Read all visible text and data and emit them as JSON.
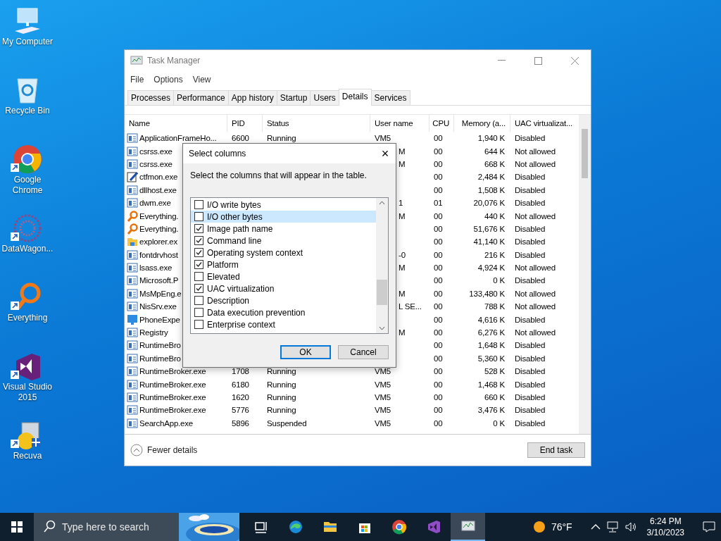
{
  "desktop_icons": [
    {
      "label": "My Computer",
      "kind": "computer",
      "shortcut": false
    },
    {
      "label": "Recycle Bin",
      "kind": "recycle",
      "shortcut": false
    },
    {
      "label": "Google Chrome",
      "kind": "chrome",
      "shortcut": true
    },
    {
      "label": "DataWagon...",
      "kind": "datawagon",
      "shortcut": true
    },
    {
      "label": "Everything",
      "kind": "everything",
      "shortcut": true
    },
    {
      "label": "Visual Studio 2015",
      "kind": "vs",
      "shortcut": true
    },
    {
      "label": "Recuva",
      "kind": "recuva",
      "shortcut": true
    }
  ],
  "window": {
    "title": "Task Manager",
    "menu": [
      "File",
      "Options",
      "View"
    ],
    "tabs": [
      {
        "label": "Processes",
        "selected": false
      },
      {
        "label": "Performance",
        "selected": false
      },
      {
        "label": "App history",
        "selected": false
      },
      {
        "label": "Startup",
        "selected": false
      },
      {
        "label": "Users",
        "selected": false
      },
      {
        "label": "Details",
        "selected": true
      },
      {
        "label": "Services",
        "selected": false
      }
    ],
    "table": {
      "columns": [
        "Name",
        "PID",
        "Status",
        "User name",
        "CPU",
        "Memory (a...",
        "UAC virtualizat..."
      ],
      "rows": [
        {
          "kind": "app",
          "name": "ApplicationFrameHo...",
          "pid": "6600",
          "status": "Running",
          "user": "VM5",
          "cpu": "00",
          "memory": "1,940 K",
          "uac": "Disabled"
        },
        {
          "kind": "app",
          "name": "csrss.exe",
          "user": "M",
          "cpu": "00",
          "memory": "644 K",
          "uac": "Not allowed"
        },
        {
          "kind": "app",
          "name": "csrss.exe",
          "user": "M",
          "cpu": "00",
          "memory": "668 K",
          "uac": "Not allowed"
        },
        {
          "kind": "pen",
          "name": "ctfmon.exe",
          "cpu": "00",
          "memory": "2,484 K",
          "uac": "Disabled"
        },
        {
          "kind": "app",
          "name": "dllhost.exe",
          "cpu": "00",
          "memory": "1,508 K",
          "uac": "Disabled"
        },
        {
          "kind": "app",
          "name": "dwm.exe",
          "user": "1",
          "cpu": "01",
          "memory": "20,076 K",
          "uac": "Disabled"
        },
        {
          "kind": "search",
          "name": "Everything.",
          "user": "M",
          "cpu": "00",
          "memory": "440 K",
          "uac": "Not allowed"
        },
        {
          "kind": "search",
          "name": "Everything.",
          "cpu": "00",
          "memory": "51,676 K",
          "uac": "Disabled"
        },
        {
          "kind": "folder",
          "name": "explorer.ex",
          "cpu": "00",
          "memory": "41,140 K",
          "uac": "Disabled"
        },
        {
          "kind": "app",
          "name": "fontdrvhost",
          "user": "-0",
          "cpu": "00",
          "memory": "216 K",
          "uac": "Disabled"
        },
        {
          "kind": "app",
          "name": "lsass.exe",
          "user": "M",
          "cpu": "00",
          "memory": "4,924 K",
          "uac": "Not allowed"
        },
        {
          "kind": "app",
          "name": "Microsoft.P",
          "cpu": "00",
          "memory": "0 K",
          "uac": "Disabled"
        },
        {
          "kind": "app",
          "name": "MsMpEng.e",
          "user": "M",
          "cpu": "00",
          "memory": "133,480 K",
          "uac": "Not allowed"
        },
        {
          "kind": "app",
          "name": "NisSrv.exe",
          "user": "L SE...",
          "cpu": "00",
          "memory": "788 K",
          "uac": "Not allowed"
        },
        {
          "kind": "monitor",
          "name": "PhoneExpe",
          "cpu": "00",
          "memory": "4,616 K",
          "uac": "Disabled"
        },
        {
          "kind": "app",
          "name": "Registry",
          "user": "M",
          "cpu": "00",
          "memory": "6,276 K",
          "uac": "Not allowed"
        },
        {
          "kind": "app",
          "name": "RuntimeBro",
          "cpu": "00",
          "memory": "1,648 K",
          "uac": "Disabled"
        },
        {
          "kind": "app",
          "name": "RuntimeBro",
          "cpu": "00",
          "memory": "5,360 K",
          "uac": "Disabled"
        },
        {
          "kind": "app",
          "name": "RuntimeBroker.exe",
          "pid": "1708",
          "status": "Running",
          "user": "VM5",
          "cpu": "00",
          "memory": "528 K",
          "uac": "Disabled"
        },
        {
          "kind": "app",
          "name": "RuntimeBroker.exe",
          "pid": "6180",
          "status": "Running",
          "user": "VM5",
          "cpu": "00",
          "memory": "1,468 K",
          "uac": "Disabled"
        },
        {
          "kind": "app",
          "name": "RuntimeBroker.exe",
          "pid": "1620",
          "status": "Running",
          "user": "VM5",
          "cpu": "00",
          "memory": "660 K",
          "uac": "Disabled"
        },
        {
          "kind": "app",
          "name": "RuntimeBroker.exe",
          "pid": "5776",
          "status": "Running",
          "user": "VM5",
          "cpu": "00",
          "memory": "3,476 K",
          "uac": "Disabled"
        },
        {
          "kind": "app",
          "name": "SearchApp.exe",
          "pid": "5896",
          "status": "Suspended",
          "user": "VM5",
          "cpu": "00",
          "memory": "0 K",
          "uac": "Disabled"
        }
      ]
    },
    "fewer_details": "Fewer details",
    "end_task": "End task"
  },
  "dialog": {
    "title": "Select columns",
    "close": "×",
    "instruction": "Select the columns that will appear in the table.",
    "items": [
      {
        "label": "I/O write bytes",
        "checked": false,
        "selected": false
      },
      {
        "label": "I/O other bytes",
        "checked": false,
        "selected": true
      },
      {
        "label": "Image path name",
        "checked": true,
        "selected": false
      },
      {
        "label": "Command line",
        "checked": true,
        "selected": false
      },
      {
        "label": "Operating system context",
        "checked": true,
        "selected": false
      },
      {
        "label": "Platform",
        "checked": true,
        "selected": false
      },
      {
        "label": "Elevated",
        "checked": false,
        "selected": false
      },
      {
        "label": "UAC virtualization",
        "checked": true,
        "selected": false
      },
      {
        "label": "Description",
        "checked": false,
        "selected": false
      },
      {
        "label": "Data execution prevention",
        "checked": false,
        "selected": false
      },
      {
        "label": "Enterprise context",
        "checked": false,
        "selected": false
      }
    ],
    "ok": "OK",
    "cancel": "Cancel"
  },
  "taskbar": {
    "search": {
      "placeholder": "Type here to search"
    },
    "apps": [
      {
        "kind": "taskview",
        "active": false
      },
      {
        "kind": "edge",
        "active": false
      },
      {
        "kind": "explorer",
        "active": false
      },
      {
        "kind": "store",
        "active": false
      },
      {
        "kind": "chrome",
        "active": false
      },
      {
        "kind": "vs",
        "active": false
      },
      {
        "kind": "taskmgr",
        "active": true
      }
    ],
    "weather": "76°F",
    "time": "6:24 PM",
    "date": "3/10/2023"
  }
}
